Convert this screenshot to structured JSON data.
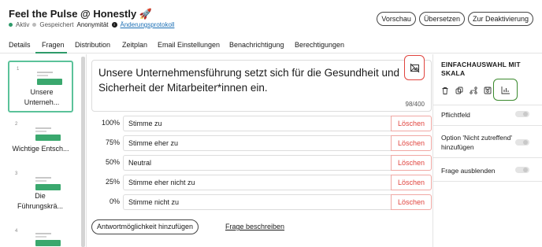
{
  "header": {
    "title": "Feel the Pulse @ Honestly 🚀",
    "status": "Aktiv",
    "saved": "Gespeichert",
    "anonymity": "Anonymität",
    "history_link": "Änderungsprotokoll"
  },
  "top_buttons": {
    "preview": "Vorschau",
    "translate": "Übersetzen",
    "deactivate": "Zur Deaktivierung"
  },
  "tabs": [
    "Details",
    "Fragen",
    "Distribution",
    "Zeitplan",
    "Email Einstellungen",
    "Benachrichtigung",
    "Berechtigungen"
  ],
  "active_tab": "Fragen",
  "sidebar": {
    "items": [
      {
        "num": "1",
        "label": "Unsere Unterneh..."
      },
      {
        "num": "2",
        "label": "Wichtige Entsch..."
      },
      {
        "num": "3",
        "label": "Die Führungskrä..."
      },
      {
        "num": "4",
        "label": ""
      }
    ]
  },
  "question": {
    "text": "Unsere Unternehmensführung setzt sich für die Gesundheit und Sicherheit der Mitarbeiter*innen ein.",
    "counter": "98/400"
  },
  "answers": [
    {
      "pct": "100%",
      "label": "Stimme zu",
      "delete": "Löschen"
    },
    {
      "pct": "75%",
      "label": "Stimme eher zu",
      "delete": "Löschen"
    },
    {
      "pct": "50%",
      "label": "Neutral",
      "delete": "Löschen"
    },
    {
      "pct": "25%",
      "label": "Stimme eher nicht zu",
      "delete": "Löschen"
    },
    {
      "pct": "0%",
      "label": "Stimme nicht zu",
      "delete": "Löschen"
    }
  ],
  "actions": {
    "add_answer": "Antwortmöglichkeit hinzufügen",
    "describe": "Frage beschreiben"
  },
  "right_panel": {
    "title": "EINFACHAUSWAHL MIT SKALA",
    "required": "Pflichtfeld",
    "not_applicable": "Option 'Nicht zutreffend' hinzufügen",
    "hide": "Frage ausblenden"
  },
  "colors": {
    "accent_green": "#2e9a6a",
    "danger_red": "#e0443e",
    "highlight_green": "#3b8a2e"
  }
}
